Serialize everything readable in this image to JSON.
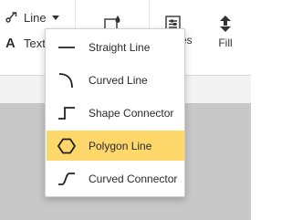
{
  "ribbon": {
    "line_label": "Line",
    "text_label": "Text",
    "styles_fragment": "es",
    "fill_label": "Fill"
  },
  "menu": {
    "items": [
      {
        "label": "Straight Line",
        "icon": "straight-line-icon"
      },
      {
        "label": "Curved Line",
        "icon": "curved-line-icon"
      },
      {
        "label": "Shape Connector",
        "icon": "shape-connector-icon"
      },
      {
        "label": "Polygon Line",
        "icon": "polygon-line-icon",
        "selected": true
      },
      {
        "label": "Curved Connector",
        "icon": "curved-connector-icon"
      }
    ],
    "highlight_color": "#fdd76a"
  },
  "colors": {
    "canvas": "#c8c8c8",
    "band": "#f3f3f3"
  }
}
